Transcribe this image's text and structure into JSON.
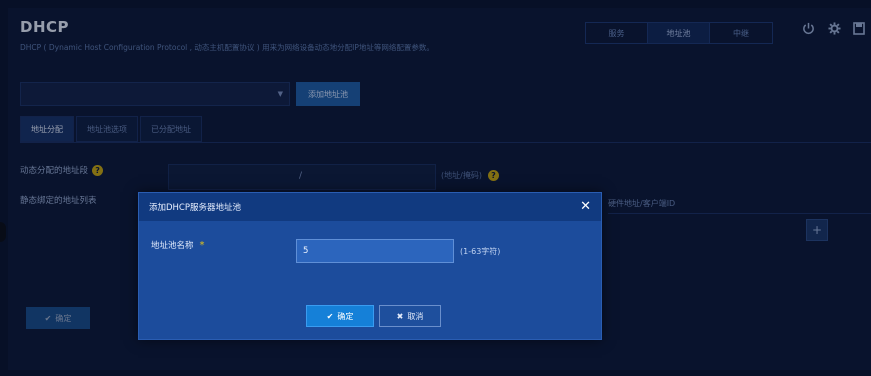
{
  "header": {
    "title": "DHCP",
    "description": "DHCP ( Dynamic Host Configuration Protocol , 动态主机配置协议 ) 用来为网络设备动态地分配IP地址等网络配置参数。"
  },
  "topnav": {
    "tabs": [
      {
        "label": "服务"
      },
      {
        "label": "地址池"
      },
      {
        "label": "中继"
      }
    ],
    "active_index": 1
  },
  "toolbar": {
    "pool_select_value": "",
    "add_pool_label": "添加地址池"
  },
  "subtabs": [
    {
      "label": "地址分配"
    },
    {
      "label": "地址池选项"
    },
    {
      "label": "已分配地址"
    }
  ],
  "form": {
    "dynamic_range_label": "动态分配的地址段",
    "range_separator": "/",
    "range_hint": "(地址/掩码)",
    "static_binding_label": "静态绑定的地址列表",
    "static_column_header": "硬件地址/客户端ID",
    "add_symbol": "+",
    "ok_label": "确定"
  },
  "modal": {
    "title": "添加DHCP服务器地址池",
    "close_symbol": "✕",
    "pool_name_label": "地址池名称",
    "required_mark": "*",
    "pool_name_value": "5",
    "pool_name_hint": "(1-63字符)",
    "ok_label": "确定",
    "cancel_label": "取消"
  },
  "colors": {
    "background": "#0d1a3a",
    "modal": "#1c4c9c",
    "primary_button": "#1580d8",
    "help_icon": "#c8a811"
  }
}
